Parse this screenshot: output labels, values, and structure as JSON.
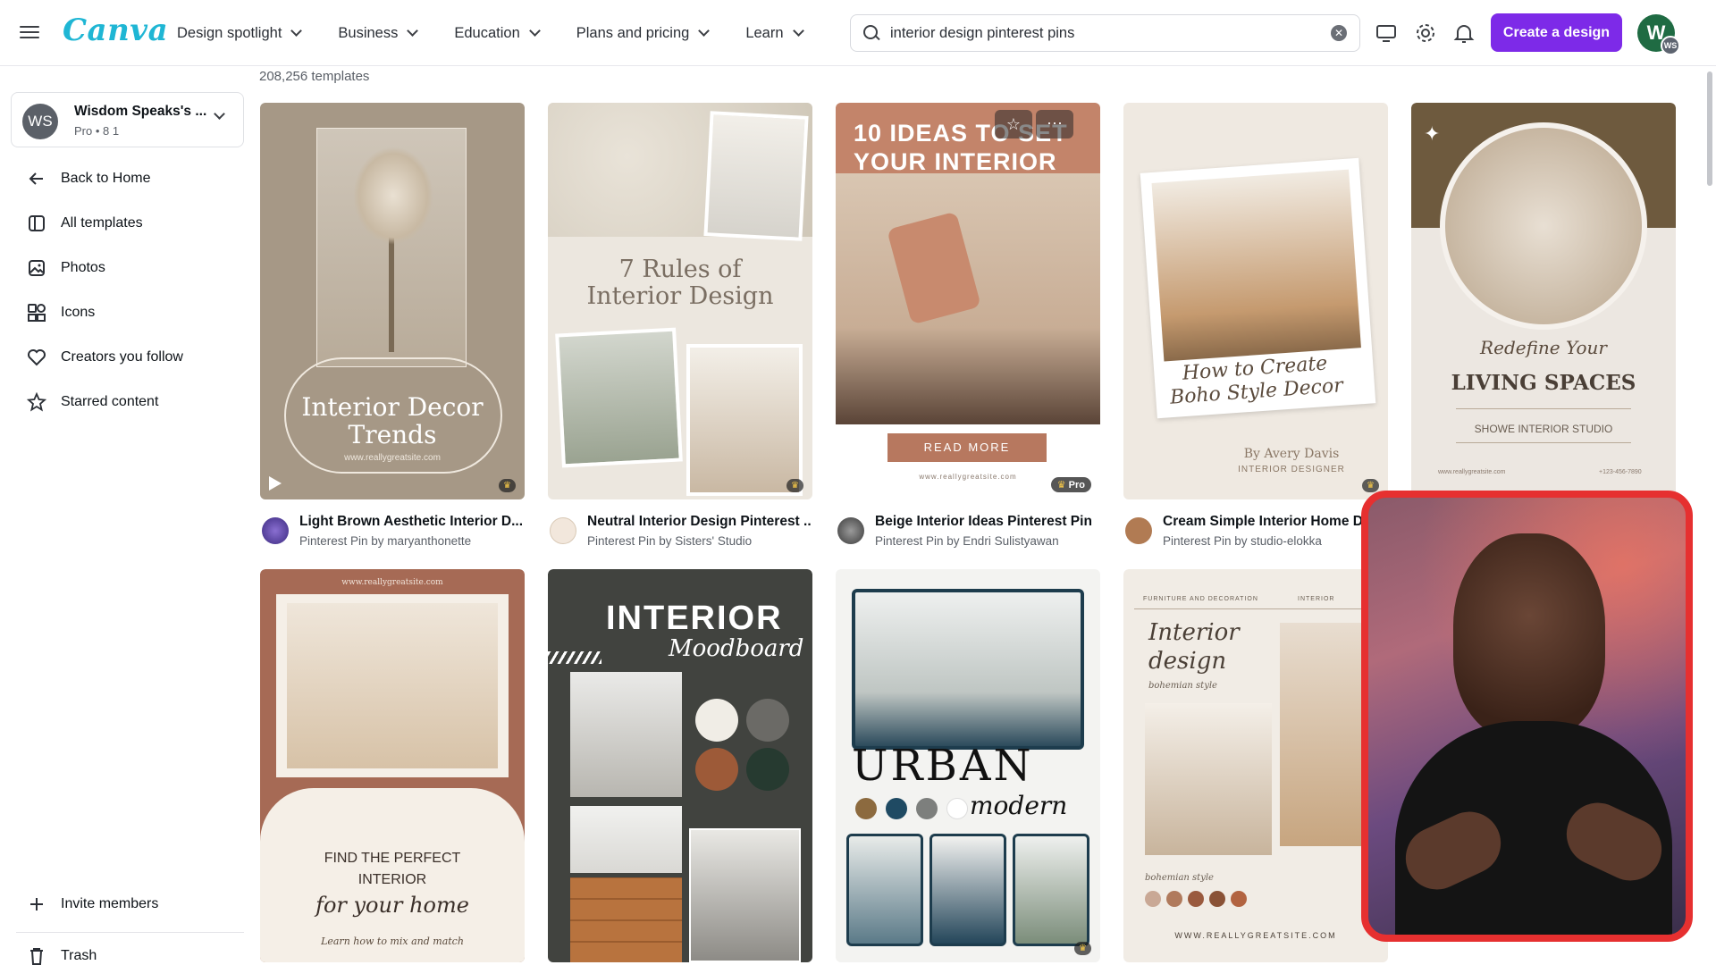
{
  "header": {
    "logo": "Canva",
    "nav": [
      {
        "label": "Design spotlight"
      },
      {
        "label": "Business"
      },
      {
        "label": "Education"
      },
      {
        "label": "Plans and pricing"
      },
      {
        "label": "Learn"
      }
    ],
    "search_value": "interior design pinterest pins",
    "create_label": "Create a design",
    "avatar_initial": "W",
    "avatar_sub": "WS"
  },
  "sidebar": {
    "team": {
      "initials": "WS",
      "name": "Wisdom Speaks's ...",
      "meta": "Pro • 8 1"
    },
    "items": [
      {
        "label": "Back to Home",
        "icon": "arrow-left-icon"
      },
      {
        "label": "All templates",
        "icon": "templates-icon"
      },
      {
        "label": "Photos",
        "icon": "photo-icon"
      },
      {
        "label": "Icons",
        "icon": "shapes-icon"
      },
      {
        "label": "Creators you follow",
        "icon": "heart-icon"
      },
      {
        "label": "Starred content",
        "icon": "star-icon"
      }
    ],
    "invite_label": "Invite members",
    "trash_label": "Trash"
  },
  "results": {
    "count": "208,256 templates",
    "cards": [
      {
        "title": "Light Brown Aesthetic Interior D...",
        "subtitle": "Pinterest Pin by maryanthonette",
        "thumb_lines": [
          "Interior Decor",
          "Trends",
          "www.reallygreatsite.com"
        ],
        "accent": "#a69886"
      },
      {
        "title": "Neutral Interior Design Pinterest ...",
        "subtitle": "Pinterest Pin by Sisters' Studio",
        "thumb_lines": [
          "7 Rules of",
          "Interior Design"
        ],
        "accent": "#ece7df"
      },
      {
        "title": "Beige Interior Ideas Pinterest Pin",
        "subtitle": "Pinterest Pin by Endri Sulistyawan",
        "thumb_lines": [
          "10 IDEAS TO SET",
          "YOUR INTERIOR",
          "READ MORE",
          "www.reallygreatsite.com"
        ],
        "badge": "Pro",
        "accent": "#b7785f"
      },
      {
        "title": "Cream Simple Interior Home D",
        "subtitle": "Pinterest Pin by studio-elokka",
        "thumb_lines": [
          "How to Create",
          "Boho Style Decor",
          "By Avery Davis",
          "INTERIOR DESIGNER"
        ],
        "accent": "#efe9e1"
      },
      {
        "title": "",
        "subtitle": "",
        "thumb_lines": [
          "Redefine Your",
          "LIVING SPACES",
          "SHOWE INTERIOR STUDIO",
          "www.reallygreatsite.com",
          "+123-456-7890"
        ],
        "accent": "#6e5a3e"
      },
      {
        "thumb_lines": [
          "www.reallygreatsite.com",
          "FIND THE PERFECT",
          "INTERIOR",
          "for your home",
          "Learn how to mix and match"
        ],
        "accent": "#a66a55"
      },
      {
        "thumb_lines": [
          "INTERIOR",
          "Moodboard"
        ],
        "accent": "#41433f"
      },
      {
        "thumb_lines": [
          "URBAN",
          "modern"
        ],
        "accent": "#f3f3f1"
      },
      {
        "thumb_lines": [
          "FURNITURE AND DECORATION",
          "INTERIOR",
          "Interior",
          "design",
          "bohemian style",
          "bohemian style",
          "WWW.REALLYGREATSITE.COM"
        ],
        "accent": "#f1ece5"
      }
    ]
  }
}
